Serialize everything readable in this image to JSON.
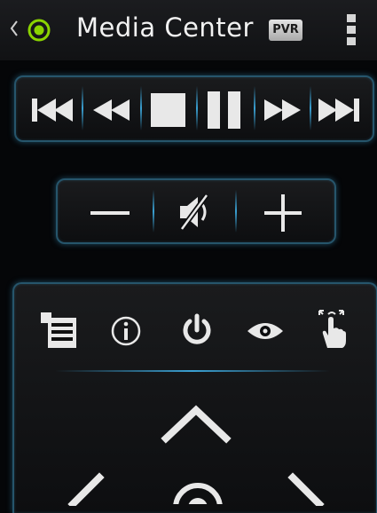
{
  "actionbar": {
    "title": "Media Center",
    "pvr_label": "PVR",
    "status_color": "#8bd400"
  },
  "transport": {
    "buttons": [
      "skip-previous",
      "rewind",
      "stop",
      "pause",
      "fast-forward",
      "skip-next"
    ]
  },
  "volume": {
    "buttons": [
      "volume-down",
      "mute",
      "volume-up"
    ]
  },
  "remote": {
    "toolbar": [
      "menu",
      "info",
      "power",
      "view",
      "gesture"
    ],
    "dpad": [
      "up",
      "left",
      "select",
      "right"
    ]
  },
  "colors": {
    "accent": "#3aa0d2",
    "icon": "#e8e8e8",
    "background": "#050608"
  }
}
